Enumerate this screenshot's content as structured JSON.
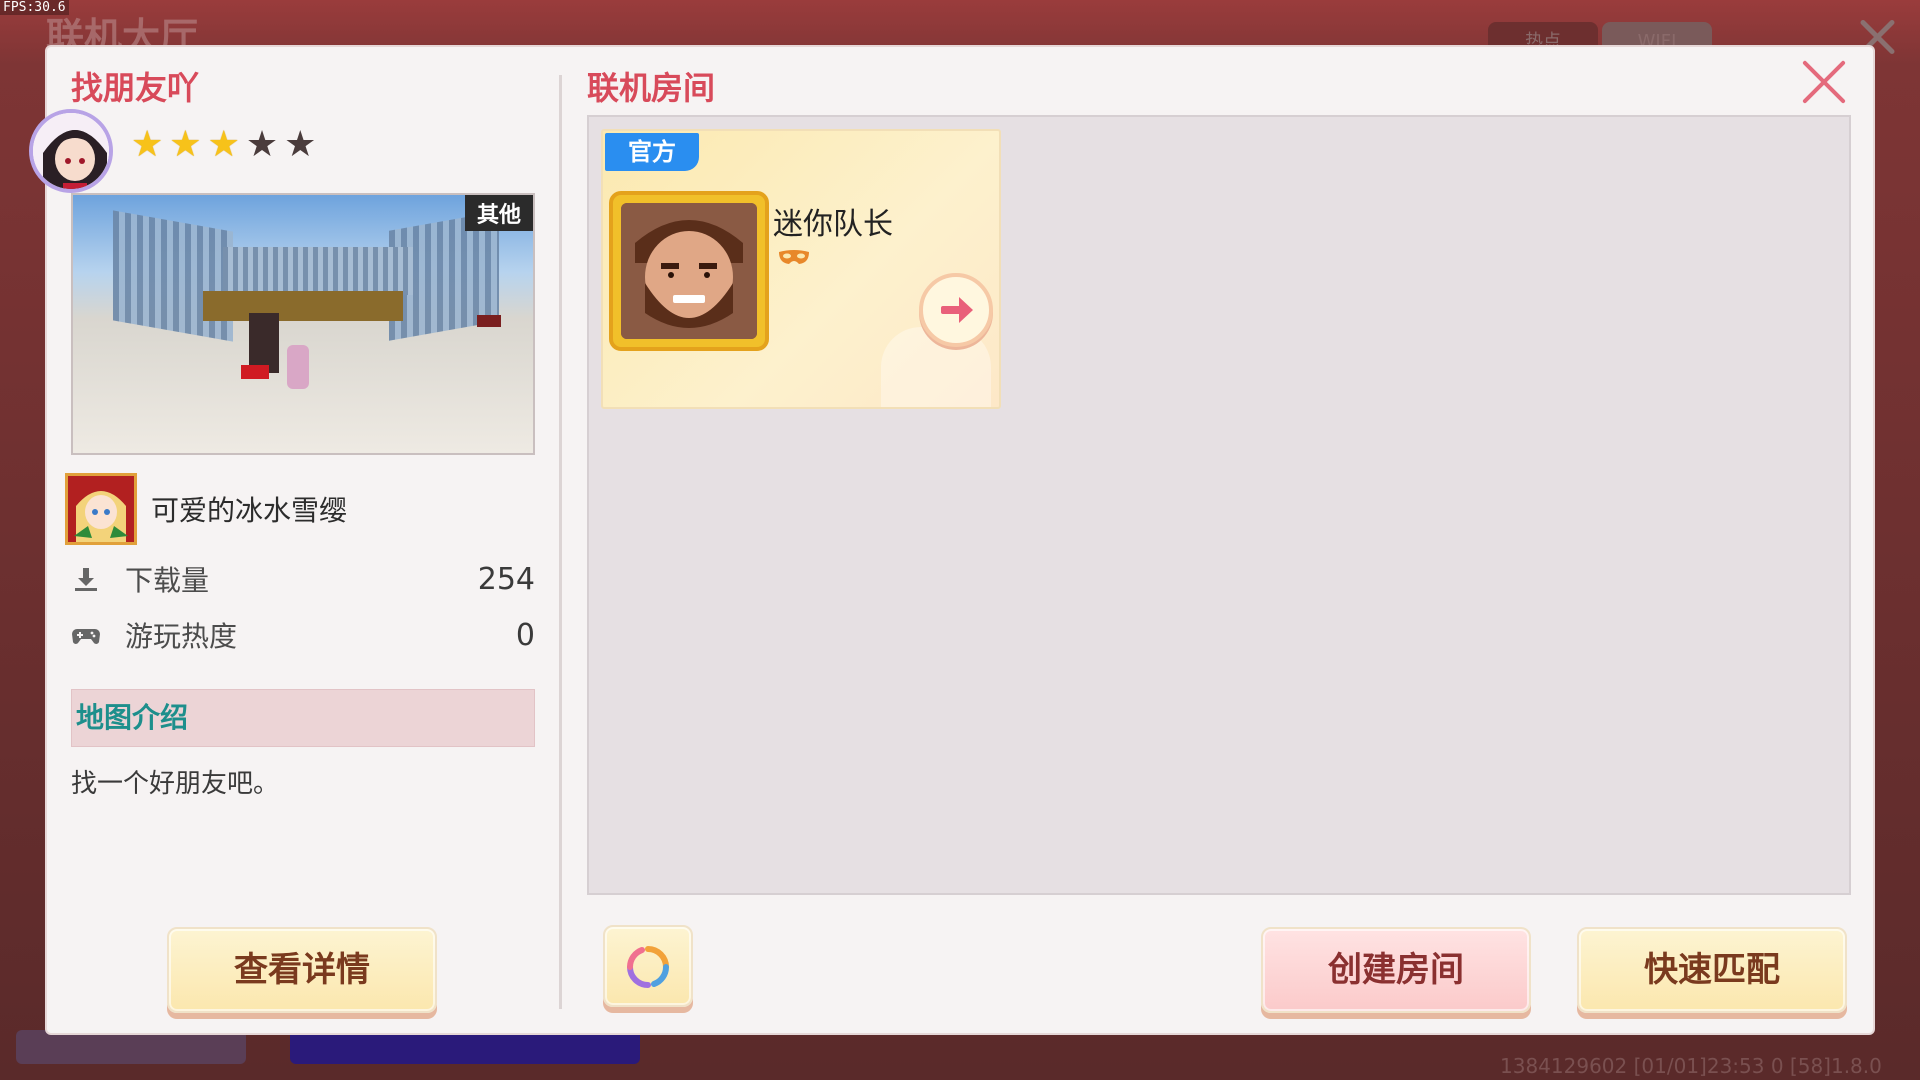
{
  "overlay": {
    "fps": "FPS:30.6",
    "bg_title": "联机大厅",
    "bg_tabs": [
      "热点",
      "WIFI"
    ],
    "bg_footer": "1384129602  [01/01]23:53 0  [58]1.8.0"
  },
  "left_panel": {
    "title": "找朋友吖",
    "rating": {
      "value": 3,
      "max": 5
    },
    "thumb_tag": "其他",
    "author": "可爱的冰水雪缨",
    "stats": [
      {
        "icon": "download-icon",
        "label": "下载量",
        "value": "254"
      },
      {
        "icon": "gamepad-icon",
        "label": "游玩热度",
        "value": "0"
      }
    ],
    "intro_heading": "地图介绍",
    "intro_text": "找一个好朋友吧。",
    "details_button": "查看详情"
  },
  "right_panel": {
    "title": "联机房间",
    "rooms": [
      {
        "tag": "官方",
        "host_name": "迷你队长",
        "badge_icon": "mask-icon"
      }
    ],
    "create_room_button": "创建房间",
    "quick_match_button": "快速匹配"
  },
  "colors": {
    "title_red": "#d84a5a",
    "intro_teal": "#1d8f8c",
    "official_blue": "#2a8ef0",
    "star_gold": "#f7c21a"
  }
}
